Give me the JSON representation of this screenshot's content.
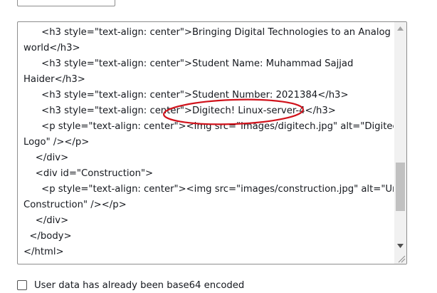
{
  "user_data_editor": {
    "lines": [
      "      <h3 style=\"text-align: center\">Bringing Digital Technologies to an Analog",
      "world</h3>",
      "      <h3 style=\"text-align: center\">Student Name: Muhammad Sajjad",
      "Haider</h3>",
      "      <h3 style=\"text-align: center\">Student Number: 2021384</h3>",
      "      <h3 style=\"text-align: center\">Digitech! Linux-server-4</h3>",
      "      <p style=\"text-align: center\"><img src=\"images/digitech.jpg\" alt=\"Digitech",
      "Logo\" /></p>",
      "    </div>",
      "    <div id=\"Construction\">",
      "      <p style=\"text-align: center\"><img src=\"images/construction.jpg\" alt=\"Under",
      "Construction\" /></p>",
      "    </div>",
      "  </body>",
      "</html>"
    ],
    "highlighted_text": ">Digitech! Linux-server-4</h3>",
    "scroll_position_percent": 72,
    "annotation_color": "#d0121b"
  },
  "options": {
    "base64_checkbox_label": "User data has already been base64 encoded",
    "base64_checked": false
  },
  "icons": {
    "scroll_up": "triangle-up-icon",
    "scroll_down": "triangle-down-icon",
    "resize": "resize-grip-icon"
  }
}
